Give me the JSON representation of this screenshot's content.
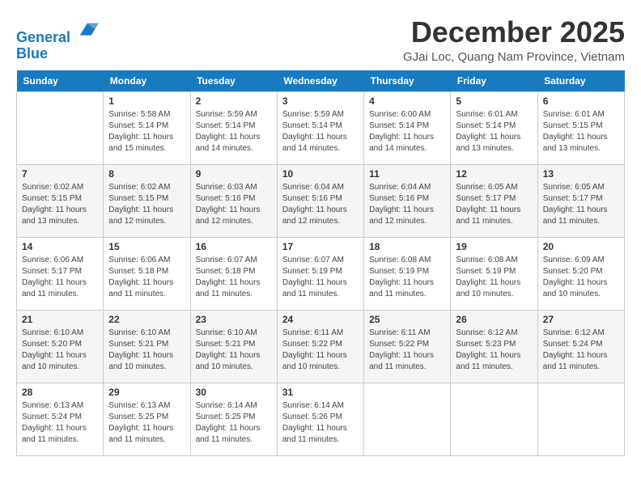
{
  "header": {
    "logo_line1": "General",
    "logo_line2": "Blue",
    "month_title": "December 2025",
    "location": "GJai Loc, Quang Nam Province, Vietnam"
  },
  "days_of_week": [
    "Sunday",
    "Monday",
    "Tuesday",
    "Wednesday",
    "Thursday",
    "Friday",
    "Saturday"
  ],
  "weeks": [
    [
      {
        "day": "",
        "info": ""
      },
      {
        "day": "1",
        "info": "Sunrise: 5:58 AM\nSunset: 5:14 PM\nDaylight: 11 hours\nand 15 minutes."
      },
      {
        "day": "2",
        "info": "Sunrise: 5:59 AM\nSunset: 5:14 PM\nDaylight: 11 hours\nand 14 minutes."
      },
      {
        "day": "3",
        "info": "Sunrise: 5:59 AM\nSunset: 5:14 PM\nDaylight: 11 hours\nand 14 minutes."
      },
      {
        "day": "4",
        "info": "Sunrise: 6:00 AM\nSunset: 5:14 PM\nDaylight: 11 hours\nand 14 minutes."
      },
      {
        "day": "5",
        "info": "Sunrise: 6:01 AM\nSunset: 5:14 PM\nDaylight: 11 hours\nand 13 minutes."
      },
      {
        "day": "6",
        "info": "Sunrise: 6:01 AM\nSunset: 5:15 PM\nDaylight: 11 hours\nand 13 minutes."
      }
    ],
    [
      {
        "day": "7",
        "info": "Sunrise: 6:02 AM\nSunset: 5:15 PM\nDaylight: 11 hours\nand 13 minutes."
      },
      {
        "day": "8",
        "info": "Sunrise: 6:02 AM\nSunset: 5:15 PM\nDaylight: 11 hours\nand 12 minutes."
      },
      {
        "day": "9",
        "info": "Sunrise: 6:03 AM\nSunset: 5:16 PM\nDaylight: 11 hours\nand 12 minutes."
      },
      {
        "day": "10",
        "info": "Sunrise: 6:04 AM\nSunset: 5:16 PM\nDaylight: 11 hours\nand 12 minutes."
      },
      {
        "day": "11",
        "info": "Sunrise: 6:04 AM\nSunset: 5:16 PM\nDaylight: 11 hours\nand 12 minutes."
      },
      {
        "day": "12",
        "info": "Sunrise: 6:05 AM\nSunset: 5:17 PM\nDaylight: 11 hours\nand 11 minutes."
      },
      {
        "day": "13",
        "info": "Sunrise: 6:05 AM\nSunset: 5:17 PM\nDaylight: 11 hours\nand 11 minutes."
      }
    ],
    [
      {
        "day": "14",
        "info": "Sunrise: 6:06 AM\nSunset: 5:17 PM\nDaylight: 11 hours\nand 11 minutes."
      },
      {
        "day": "15",
        "info": "Sunrise: 6:06 AM\nSunset: 5:18 PM\nDaylight: 11 hours\nand 11 minutes."
      },
      {
        "day": "16",
        "info": "Sunrise: 6:07 AM\nSunset: 5:18 PM\nDaylight: 11 hours\nand 11 minutes."
      },
      {
        "day": "17",
        "info": "Sunrise: 6:07 AM\nSunset: 5:19 PM\nDaylight: 11 hours\nand 11 minutes."
      },
      {
        "day": "18",
        "info": "Sunrise: 6:08 AM\nSunset: 5:19 PM\nDaylight: 11 hours\nand 11 minutes."
      },
      {
        "day": "19",
        "info": "Sunrise: 6:08 AM\nSunset: 5:19 PM\nDaylight: 11 hours\nand 10 minutes."
      },
      {
        "day": "20",
        "info": "Sunrise: 6:09 AM\nSunset: 5:20 PM\nDaylight: 11 hours\nand 10 minutes."
      }
    ],
    [
      {
        "day": "21",
        "info": "Sunrise: 6:10 AM\nSunset: 5:20 PM\nDaylight: 11 hours\nand 10 minutes."
      },
      {
        "day": "22",
        "info": "Sunrise: 6:10 AM\nSunset: 5:21 PM\nDaylight: 11 hours\nand 10 minutes."
      },
      {
        "day": "23",
        "info": "Sunrise: 6:10 AM\nSunset: 5:21 PM\nDaylight: 11 hours\nand 10 minutes."
      },
      {
        "day": "24",
        "info": "Sunrise: 6:11 AM\nSunset: 5:22 PM\nDaylight: 11 hours\nand 10 minutes."
      },
      {
        "day": "25",
        "info": "Sunrise: 6:11 AM\nSunset: 5:22 PM\nDaylight: 11 hours\nand 11 minutes."
      },
      {
        "day": "26",
        "info": "Sunrise: 6:12 AM\nSunset: 5:23 PM\nDaylight: 11 hours\nand 11 minutes."
      },
      {
        "day": "27",
        "info": "Sunrise: 6:12 AM\nSunset: 5:24 PM\nDaylight: 11 hours\nand 11 minutes."
      }
    ],
    [
      {
        "day": "28",
        "info": "Sunrise: 6:13 AM\nSunset: 5:24 PM\nDaylight: 11 hours\nand 11 minutes."
      },
      {
        "day": "29",
        "info": "Sunrise: 6:13 AM\nSunset: 5:25 PM\nDaylight: 11 hours\nand 11 minutes."
      },
      {
        "day": "30",
        "info": "Sunrise: 6:14 AM\nSunset: 5:25 PM\nDaylight: 11 hours\nand 11 minutes."
      },
      {
        "day": "31",
        "info": "Sunrise: 6:14 AM\nSunset: 5:26 PM\nDaylight: 11 hours\nand 11 minutes."
      },
      {
        "day": "",
        "info": ""
      },
      {
        "day": "",
        "info": ""
      },
      {
        "day": "",
        "info": ""
      }
    ]
  ]
}
